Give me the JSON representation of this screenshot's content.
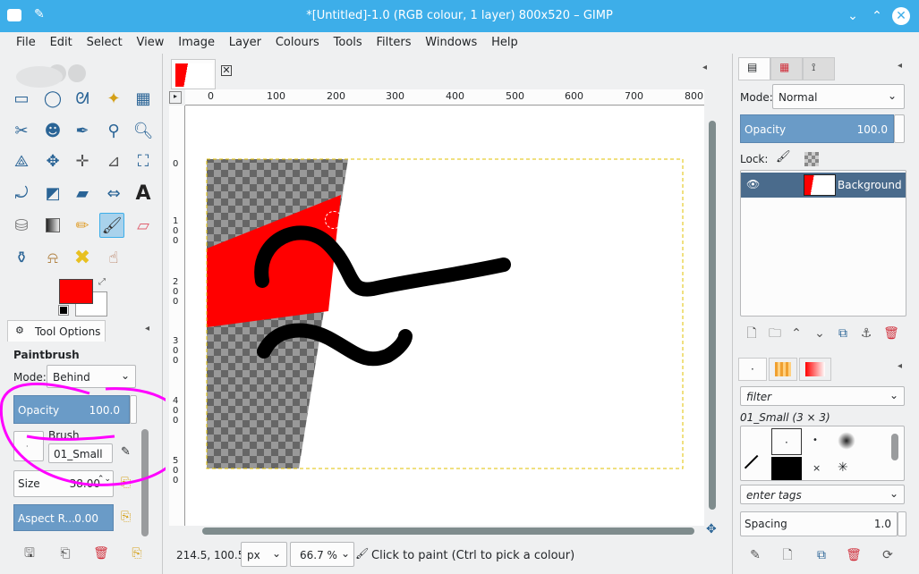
{
  "window": {
    "title": "*[Untitled]-1.0 (RGB colour, 1 layer) 800x520 – GIMP"
  },
  "menu": [
    "File",
    "Edit",
    "Select",
    "View",
    "Image",
    "Layer",
    "Colours",
    "Tools",
    "Filters",
    "Windows",
    "Help"
  ],
  "toolbox": {
    "tool_options_tab": "Tool Options",
    "tool_name": "Paintbrush",
    "mode_label": "Mode:",
    "mode_value": "Behind",
    "opacity_label": "Opacity",
    "opacity_value": "100.0",
    "brush_label": "Brush",
    "brush_name": "01_Small",
    "size_label": "Size",
    "size_value": "38.00",
    "aspect_label": "Aspect R...",
    "aspect_value": "0.00",
    "fg_color": "#ff0000",
    "bg_color": "#ffffff"
  },
  "rulers": {
    "top": [
      "0",
      "100",
      "200",
      "300",
      "400",
      "500",
      "600",
      "700",
      "800"
    ],
    "left": [
      "0",
      "1\n0\n0",
      "2\n0\n0",
      "3\n0\n0",
      "4\n0\n0",
      "5\n0\n0"
    ]
  },
  "status": {
    "coords": "214.5, 100.5",
    "unit": "px",
    "zoom": "66.7 %",
    "message": "Click to paint (Ctrl to pick a colour)"
  },
  "layers": {
    "mode_label": "Mode:",
    "mode_value": "Normal",
    "opacity_label": "Opacity",
    "opacity_value": "100.0",
    "lock_label": "Lock:",
    "layer_name": "Background"
  },
  "brushes": {
    "filter_placeholder": "filter",
    "selected_brush": "01_Small (3 × 3)",
    "tags_placeholder": "enter tags",
    "spacing_label": "Spacing",
    "spacing_value": "1.0"
  },
  "colors": {
    "accent": "#3daee9",
    "spin": "#6a9bc7",
    "layer_selected": "#4a6b8c",
    "annotation": "#ff00ff"
  }
}
